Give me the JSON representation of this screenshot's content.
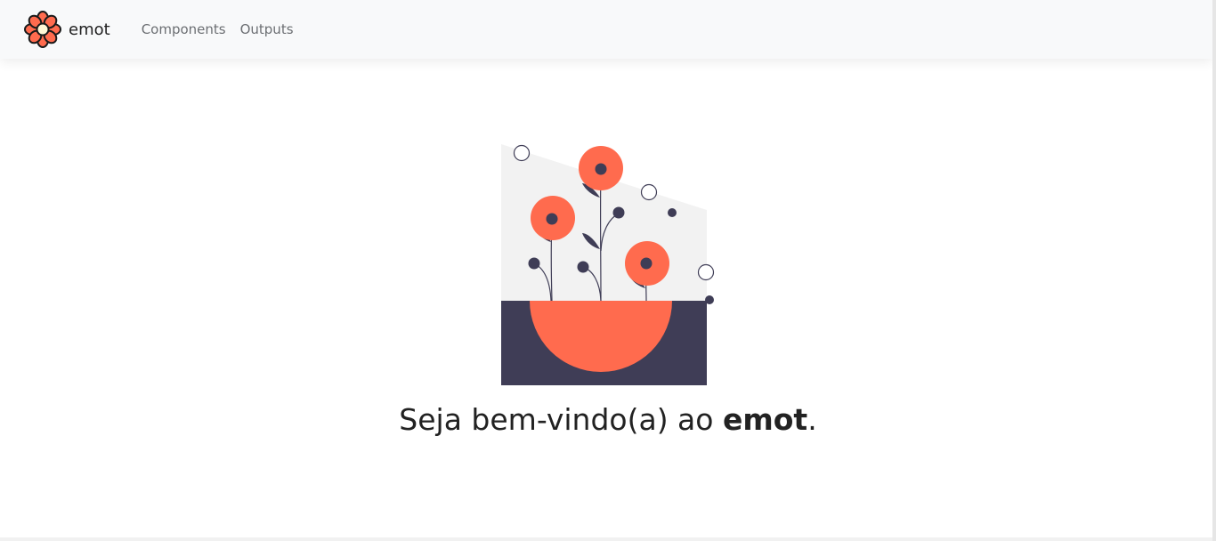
{
  "navbar": {
    "brand": {
      "icon": "flower-icon",
      "name": "emot"
    },
    "links": [
      {
        "label": "Components"
      },
      {
        "label": "Outputs"
      }
    ]
  },
  "hero": {
    "illustration": "flower-pot-illustration",
    "welcome_prefix": "Seja bem-vindo(a) ao ",
    "welcome_brand": "emot",
    "welcome_suffix": "."
  },
  "colors": {
    "accent": "#ff6b4e",
    "dark": "#3f3d56",
    "background_panel": "#f2f2f2",
    "navbar": "#f8f9fa"
  }
}
